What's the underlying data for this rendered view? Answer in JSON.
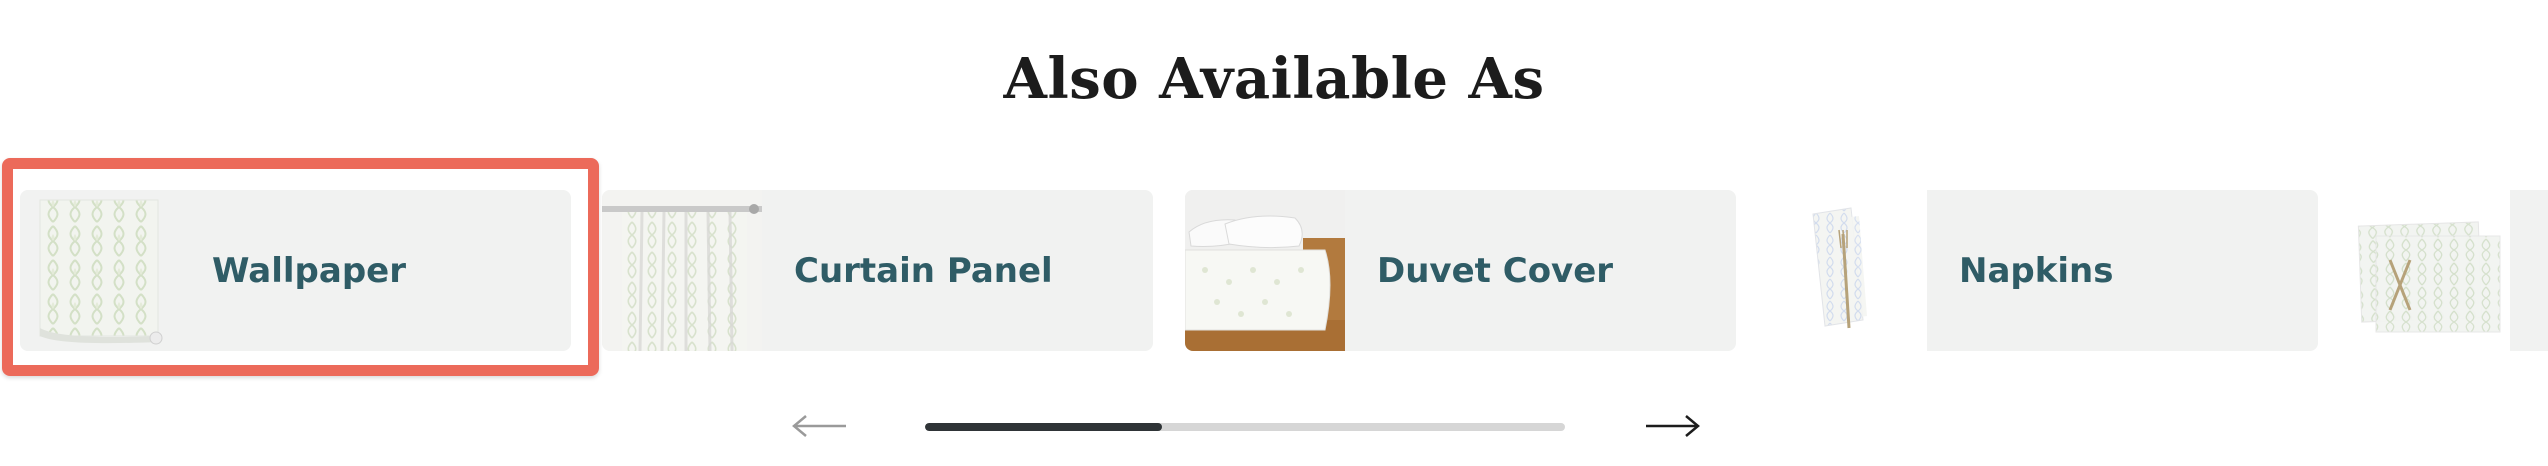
{
  "section": {
    "title": "Also Available As"
  },
  "products": [
    {
      "label": "Wallpaper",
      "thumb_icon": "wallpaper-roll-icon",
      "selected": true
    },
    {
      "label": "Curtain Panel",
      "thumb_icon": "curtain-panel-icon",
      "selected": false
    },
    {
      "label": "Duvet Cover",
      "thumb_icon": "duvet-cover-icon",
      "selected": false
    },
    {
      "label": "Napkins",
      "thumb_icon": "napkins-icon",
      "selected": false
    },
    {
      "label": "",
      "thumb_icon": "placemats-icon",
      "selected": false
    }
  ],
  "carousel": {
    "prev_icon": "arrow-left-icon",
    "next_icon": "arrow-right-icon",
    "scroll_progress": 0.37
  },
  "colors": {
    "selected_outline": "#ec6a5a",
    "label_text": "#2f5c66",
    "card_bg": "#f1f2f1",
    "progress_fill": "#2f3437",
    "progress_track": "#d6d6d6"
  }
}
